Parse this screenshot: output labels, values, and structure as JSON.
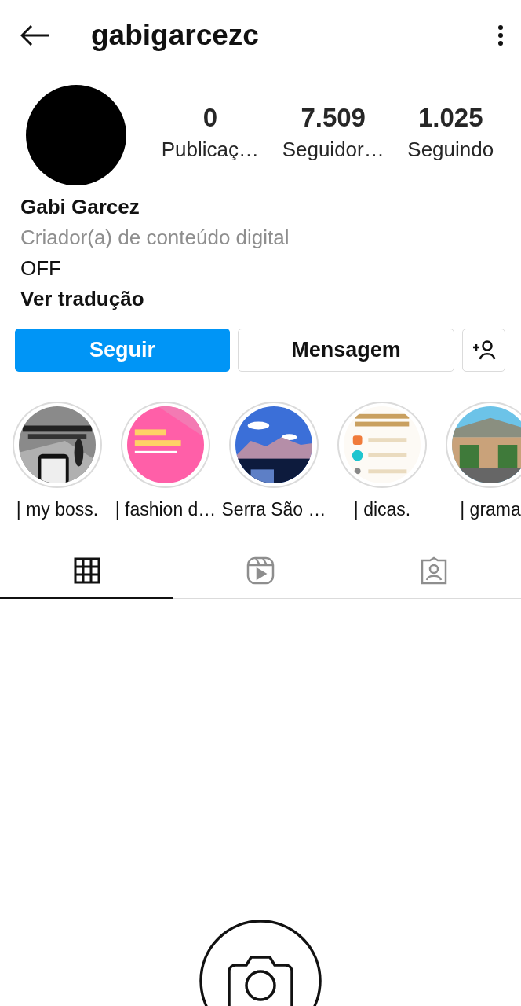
{
  "header": {
    "username": "gabigarcezc"
  },
  "stats": [
    {
      "value": "0",
      "label": "Publicaç…"
    },
    {
      "value": "7.509",
      "label": "Seguidor…"
    },
    {
      "value": "1.025",
      "label": "Seguindo"
    }
  ],
  "bio": {
    "name": "Gabi Garcez",
    "category": "Criador(a) de conteúdo digital",
    "text": "OFF",
    "translate": "Ver tradução"
  },
  "actions": {
    "follow": "Seguir",
    "message": "Mensagem"
  },
  "highlights": [
    {
      "title": "| my boss."
    },
    {
      "title": "| fashion d…"
    },
    {
      "title": "Serra São …"
    },
    {
      "title": "| dicas."
    },
    {
      "title": "| grama"
    }
  ],
  "tabs": [
    {
      "kind": "grid",
      "selected": true
    },
    {
      "kind": "reels",
      "selected": false
    },
    {
      "kind": "tagged",
      "selected": false
    }
  ]
}
